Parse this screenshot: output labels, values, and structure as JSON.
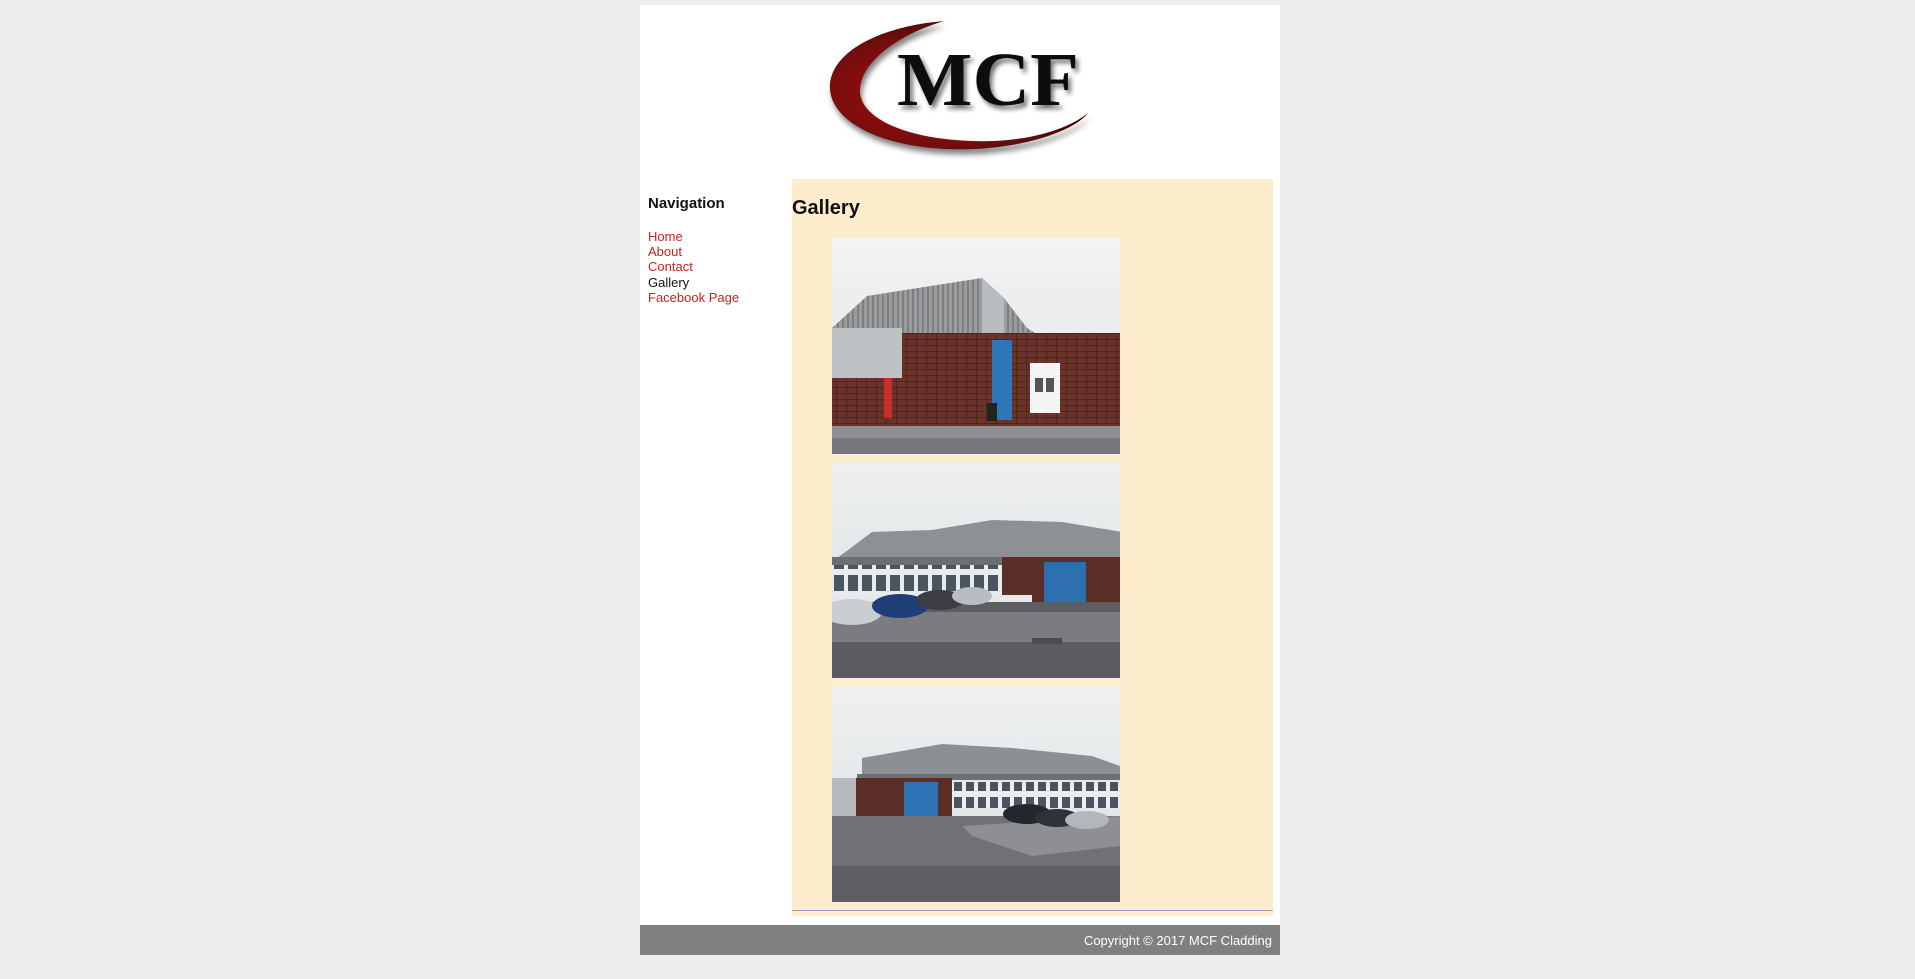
{
  "site": {
    "logo_text": "MCF"
  },
  "colors": {
    "background": "#eeeeee",
    "page": "#ffffff",
    "content_background": "#feedcc",
    "link": "#cc1f1f",
    "active_link": "#111111",
    "footer_background": "#808080",
    "footer_text": "#ffffff",
    "logo_swoosh": "#7a0d0d"
  },
  "sidebar": {
    "heading": "Navigation",
    "items": [
      {
        "label": "Home",
        "active": false
      },
      {
        "label": "About",
        "active": false
      },
      {
        "label": "Contact",
        "active": false
      },
      {
        "label": "Gallery",
        "active": true
      },
      {
        "label": "Facebook Page",
        "active": false
      }
    ]
  },
  "content": {
    "title": "Gallery",
    "photos": [
      "building-photo",
      "building-photo",
      "building-photo"
    ]
  },
  "footer": {
    "copyright": "Copyright © 2017 MCF Cladding"
  }
}
